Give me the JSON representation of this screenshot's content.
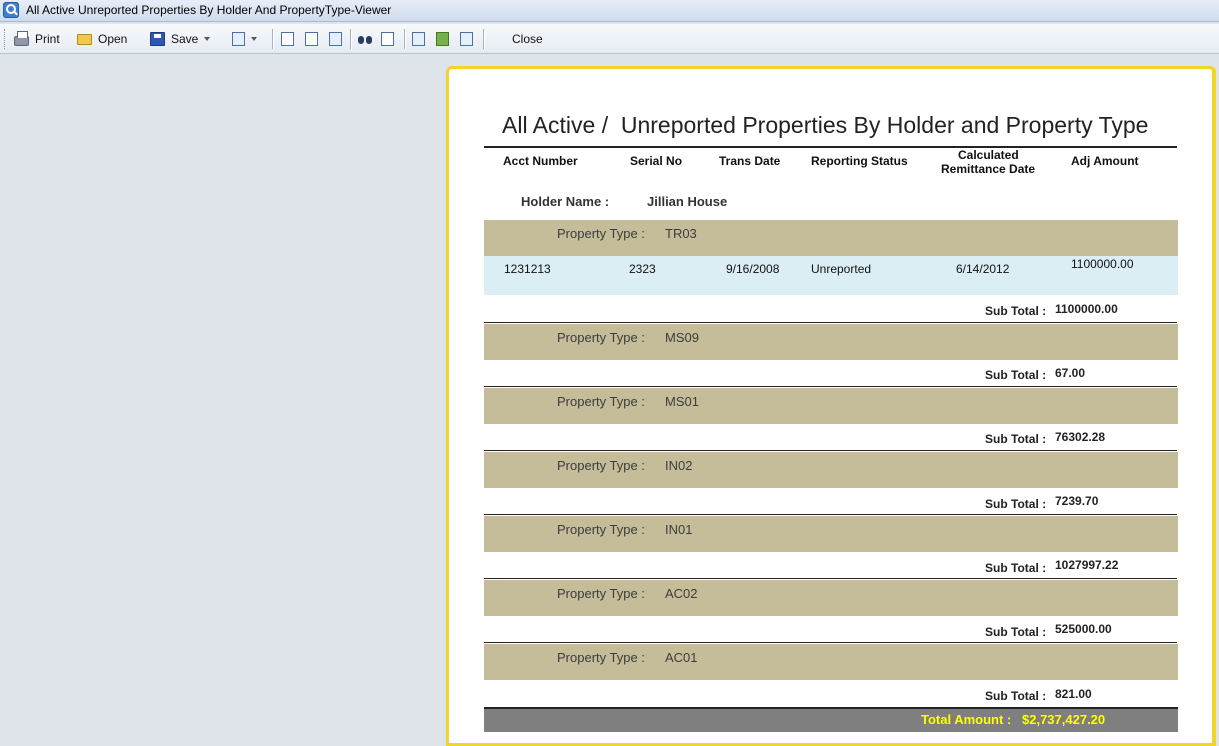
{
  "window": {
    "title": "All Active Unreported Properties By Holder And PropertyType-Viewer"
  },
  "toolbar": {
    "print": "Print",
    "open": "Open",
    "save": "Save",
    "close": "Close"
  },
  "report": {
    "title": "All Active /  Unreported Properties By Holder and Property Type",
    "columns": {
      "acct": "Acct Number",
      "serial": "Serial No",
      "trans_date": "Trans Date",
      "status": "Reporting Status",
      "calc_1": "Calculated",
      "calc_2": "Remittance Date",
      "adj": "Adj Amount"
    },
    "holder_label": "Holder Name :",
    "holder_name": "Jillian House",
    "ptype_label": "Property Type :",
    "subtotal_label": "Sub Total :",
    "groups": [
      {
        "type": "TR03",
        "subtotal": "1100000.00"
      },
      {
        "type": "MS09",
        "subtotal": "67.00"
      },
      {
        "type": "MS01",
        "subtotal": "76302.28"
      },
      {
        "type": "IN02",
        "subtotal": "7239.70"
      },
      {
        "type": "IN01",
        "subtotal": "1027997.22"
      },
      {
        "type": "AC02",
        "subtotal": "525000.00"
      },
      {
        "type": "AC01",
        "subtotal": "821.00"
      }
    ],
    "detail": {
      "acct": "1231213",
      "serial": "2323",
      "trans_date": "9/16/2008",
      "status": "Unreported",
      "remit_date": "6/14/2012",
      "adj": "1100000.00"
    },
    "total_label": "Total Amount :",
    "total_value": "$2,737,427.20"
  }
}
